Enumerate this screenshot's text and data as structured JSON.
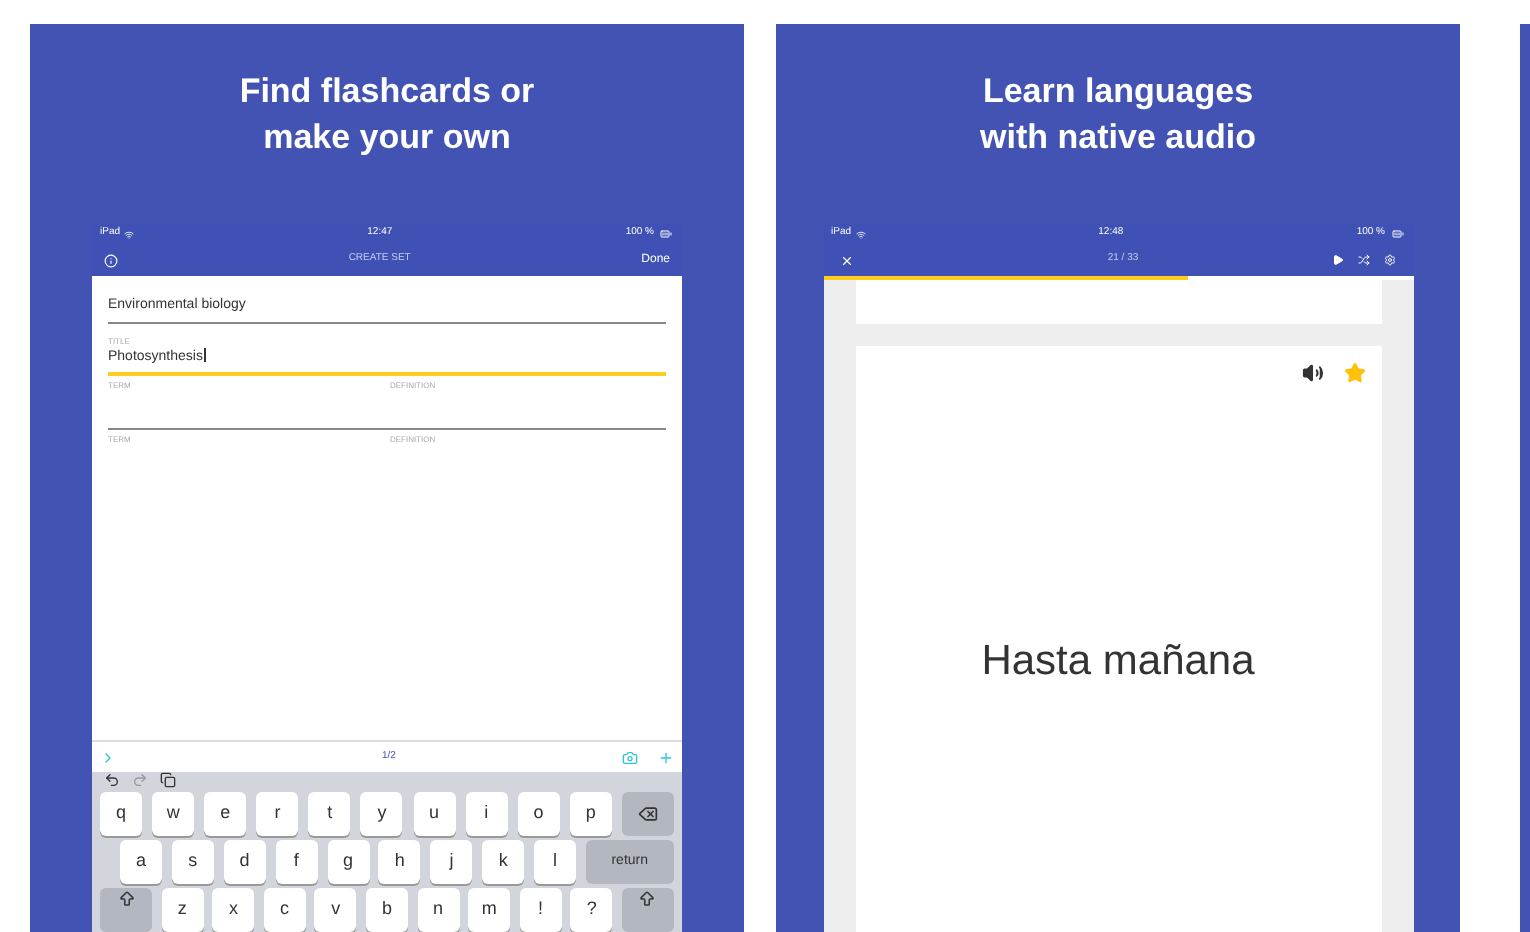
{
  "panels": [
    {
      "kind": "create",
      "headline": [
        "Find flashcards or",
        "make your own"
      ],
      "status": {
        "carrier": "iPad",
        "time": "12:47",
        "battery": "100 %"
      },
      "nav": {
        "title": "CREATE SET",
        "action": "Done"
      },
      "fields": [
        {
          "kind": "value",
          "value": "Environmental biology",
          "focused": false
        },
        {
          "kind": "value",
          "label": "TITLE",
          "value": "Photosynthesis",
          "focused": true
        },
        {
          "kind": "pair",
          "label": "TERM",
          "label_2": "DEFINITION",
          "focused": false
        },
        {
          "kind": "pair",
          "label": "TERM",
          "label_2": "DEFINITION",
          "focused": false
        }
      ],
      "toolbar": {
        "page": "1/2"
      },
      "keyboard": [
        [
          {
            "kind": "char",
            "label": "q"
          },
          {
            "kind": "char",
            "label": "w"
          },
          {
            "kind": "char",
            "label": "e"
          },
          {
            "kind": "char",
            "label": "r"
          },
          {
            "kind": "char",
            "label": "t"
          },
          {
            "kind": "char",
            "label": "y"
          },
          {
            "kind": "char",
            "label": "u"
          },
          {
            "kind": "char",
            "label": "i"
          },
          {
            "kind": "char",
            "label": "o"
          },
          {
            "kind": "char",
            "label": "p"
          },
          {
            "kind": "backspace"
          }
        ],
        [
          {
            "kind": "char",
            "label": "a"
          },
          {
            "kind": "char",
            "label": "s"
          },
          {
            "kind": "char",
            "label": "d"
          },
          {
            "kind": "char",
            "label": "f"
          },
          {
            "kind": "char",
            "label": "g"
          },
          {
            "kind": "char",
            "label": "h"
          },
          {
            "kind": "char",
            "label": "j"
          },
          {
            "kind": "char",
            "label": "k"
          },
          {
            "kind": "char",
            "label": "l"
          },
          {
            "kind": "return",
            "label": "return"
          }
        ],
        [
          {
            "kind": "shift"
          },
          {
            "kind": "char",
            "label": "z"
          },
          {
            "kind": "char",
            "label": "x"
          },
          {
            "kind": "char",
            "label": "c"
          },
          {
            "kind": "char",
            "label": "v"
          },
          {
            "kind": "char",
            "label": "b"
          },
          {
            "kind": "char",
            "label": "n"
          },
          {
            "kind": "char",
            "label": "m"
          },
          {
            "kind": "char",
            "label": "!"
          },
          {
            "kind": "char",
            "label": "?"
          },
          {
            "kind": "shift"
          }
        ]
      ]
    },
    {
      "kind": "study",
      "headline": [
        "Learn languages",
        "with native audio"
      ],
      "status": {
        "carrier": "iPad",
        "time": "12:48",
        "battery": "100 %"
      },
      "nav": {
        "title": "21 / 33"
      },
      "progress": {
        "level": 0.62
      },
      "card": {
        "text": "Hasta mañana",
        "starred": true
      }
    },
    {
      "kind": "edge"
    }
  ]
}
